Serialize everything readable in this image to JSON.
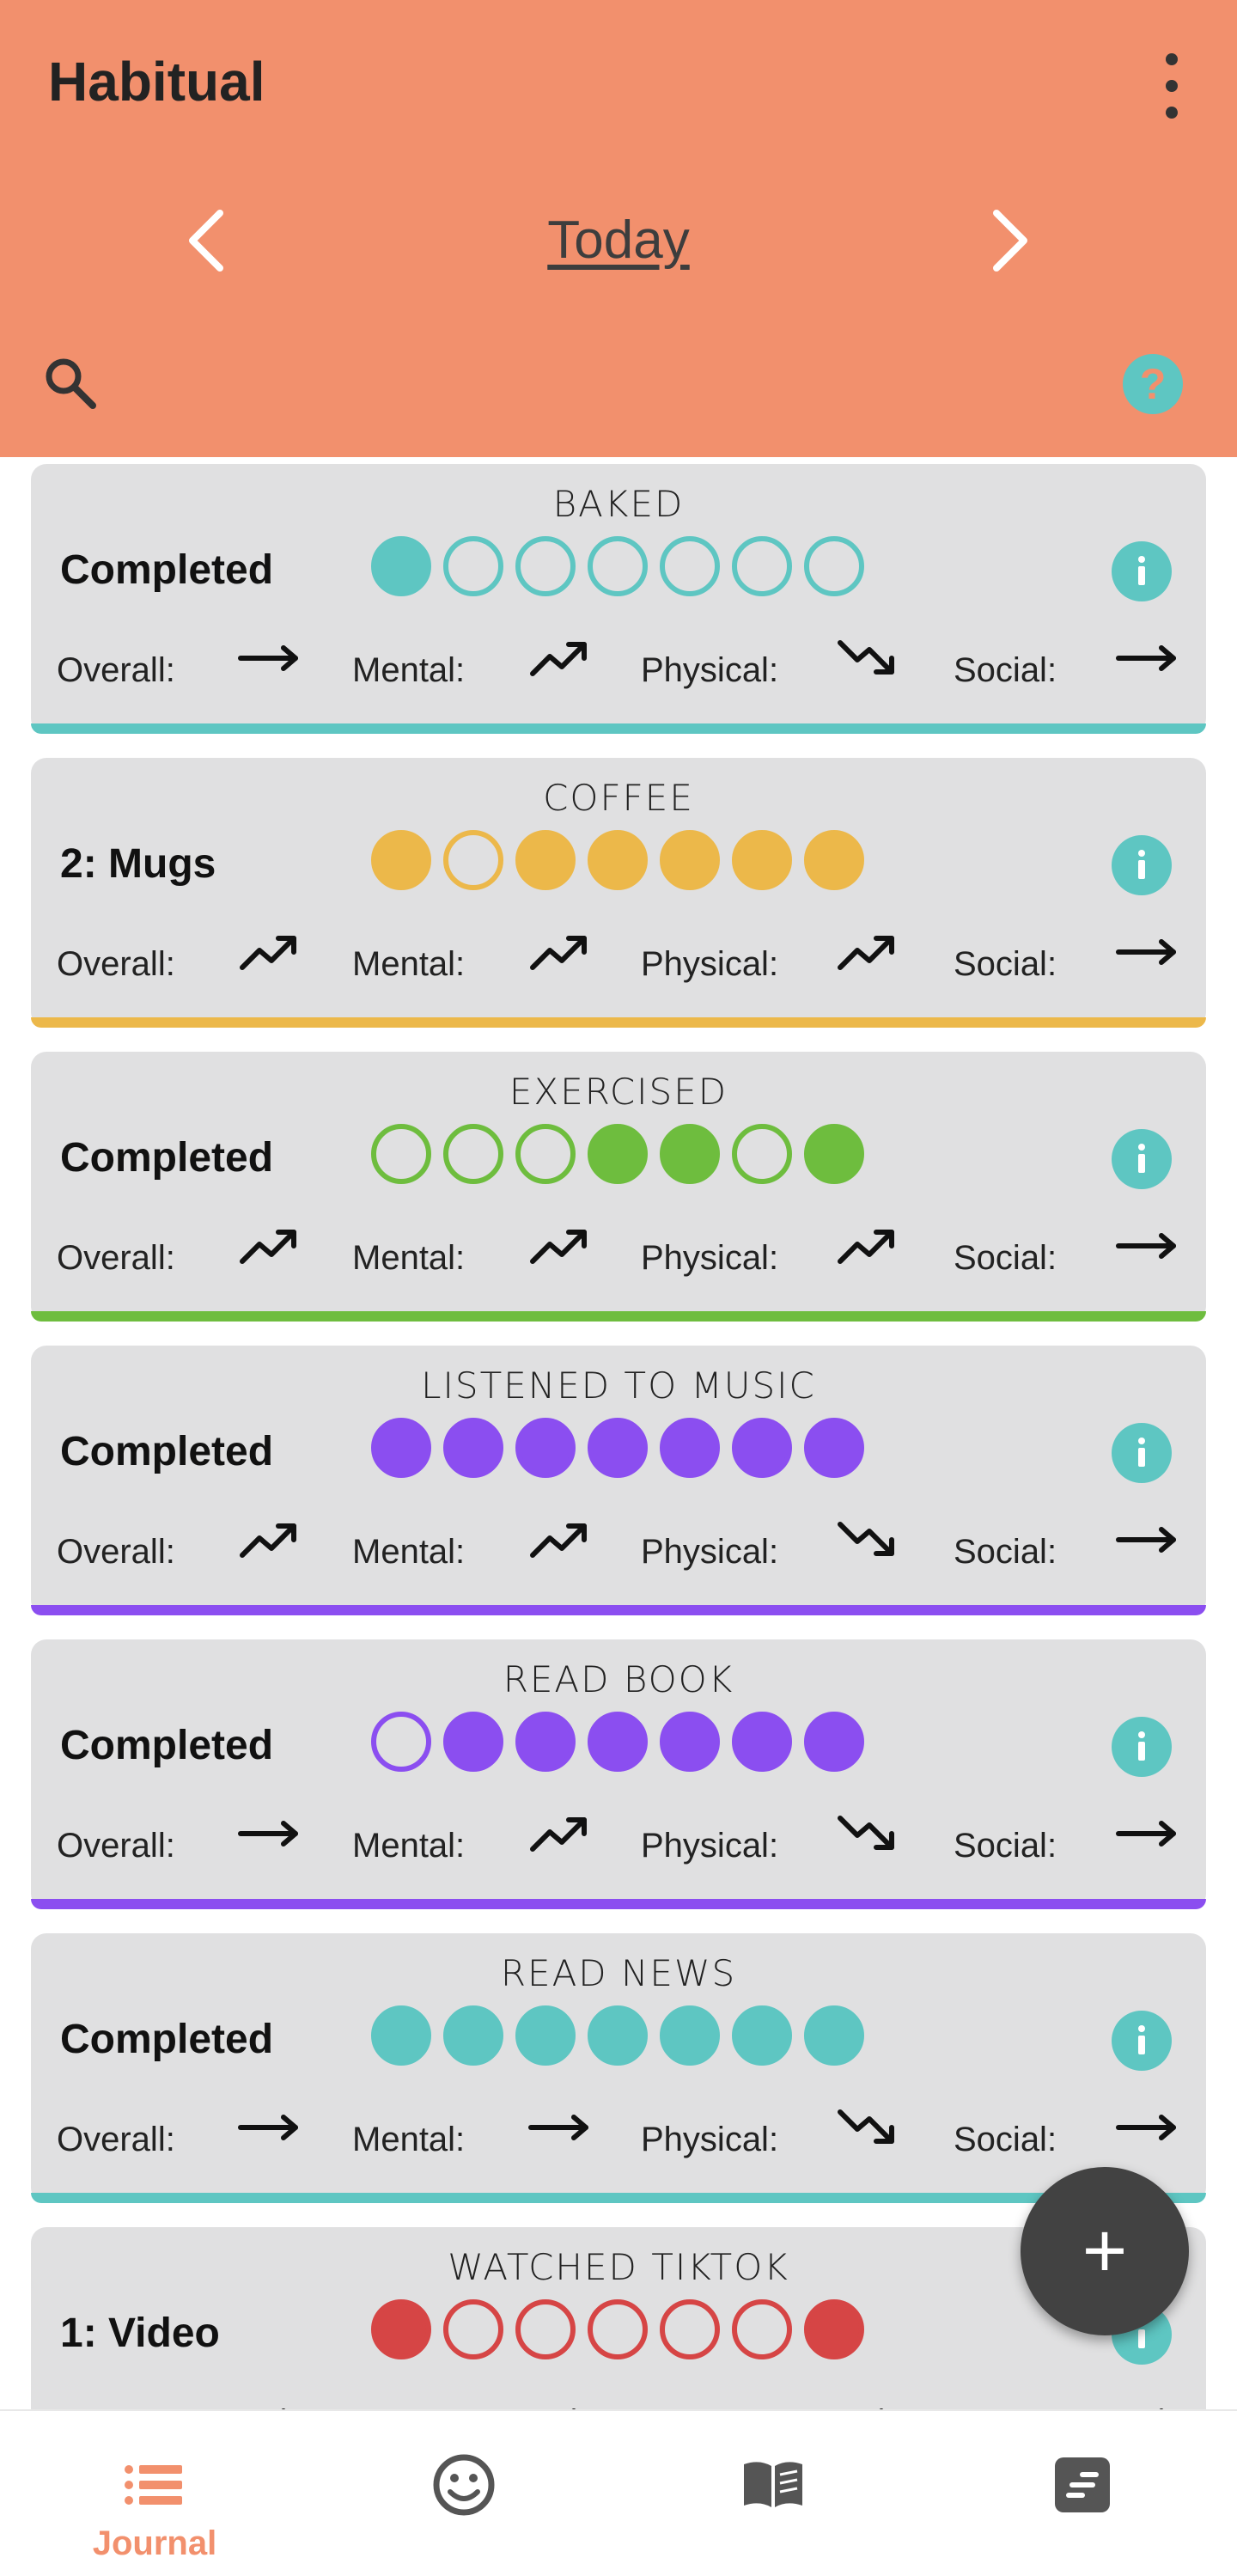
{
  "app": {
    "title": "Habitual",
    "date_label": "Today",
    "help_glyph": "?"
  },
  "icons": {
    "menu": "more-vert-icon",
    "prev": "chevron-left-icon",
    "next": "chevron-right-icon",
    "search": "search-icon",
    "help": "help-icon",
    "info": "info-icon",
    "add": "plus-icon"
  },
  "colors": {
    "header": "#f2906d",
    "teal": "#5ec6c2",
    "yellow": "#ecb84a",
    "green": "#6ebd3e",
    "purple": "#8b4ef0",
    "red": "#d64545",
    "card_bg": "#e0e0e1"
  },
  "labels": {
    "overall": "Overall:",
    "mental": "Mental:",
    "physical": "Physical:",
    "social": "Social:"
  },
  "fab": {
    "label": "+"
  },
  "habits": [
    {
      "title": "BAKED",
      "status": "Completed",
      "color": "#5ec6c2",
      "days": [
        true,
        false,
        false,
        false,
        false,
        false,
        false
      ],
      "trends": {
        "overall": "flat",
        "mental": "up",
        "physical": "down",
        "social": "flat"
      }
    },
    {
      "title": "COFFEE",
      "status": "2: Mugs",
      "color": "#ecb84a",
      "days": [
        true,
        false,
        true,
        true,
        true,
        true,
        true
      ],
      "trends": {
        "overall": "up",
        "mental": "up",
        "physical": "up",
        "social": "flat"
      }
    },
    {
      "title": "EXERCISED",
      "status": "Completed",
      "color": "#6ebd3e",
      "days": [
        false,
        false,
        false,
        true,
        true,
        false,
        true
      ],
      "trends": {
        "overall": "up",
        "mental": "up",
        "physical": "up",
        "social": "flat"
      }
    },
    {
      "title": "LISTENED TO MUSIC",
      "status": "Completed",
      "color": "#8b4ef0",
      "days": [
        true,
        true,
        true,
        true,
        true,
        true,
        true
      ],
      "trends": {
        "overall": "up",
        "mental": "up",
        "physical": "down",
        "social": "flat"
      }
    },
    {
      "title": "READ BOOK",
      "status": "Completed",
      "color": "#8b4ef0",
      "days": [
        false,
        true,
        true,
        true,
        true,
        true,
        true
      ],
      "trends": {
        "overall": "flat",
        "mental": "up",
        "physical": "down",
        "social": "flat"
      }
    },
    {
      "title": "READ NEWS",
      "status": "Completed",
      "color": "#5ec6c2",
      "days": [
        true,
        true,
        true,
        true,
        true,
        true,
        true
      ],
      "trends": {
        "overall": "flat",
        "mental": "flat",
        "physical": "down",
        "social": "flat"
      }
    },
    {
      "title": "WATCHED TIKTOK",
      "status": "1: Video",
      "color": "#d64545",
      "days": [
        true,
        false,
        false,
        false,
        false,
        false,
        true
      ],
      "trends": {
        "overall": "flat",
        "mental": "flat",
        "physical": "flat",
        "social": "flat"
      }
    }
  ],
  "bottom_nav": [
    {
      "label": "Journal",
      "icon": "list-icon",
      "active": true
    },
    {
      "label": "",
      "icon": "smiley-icon",
      "active": false
    },
    {
      "label": "",
      "icon": "book-icon",
      "active": false
    },
    {
      "label": "",
      "icon": "notes-icon",
      "active": false
    }
  ]
}
